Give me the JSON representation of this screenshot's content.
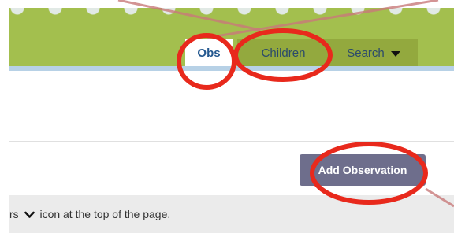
{
  "nav": {
    "tabs": [
      {
        "label": "Obs",
        "active": true
      },
      {
        "label": "Children",
        "active": false
      },
      {
        "label": "Search",
        "active": false
      }
    ]
  },
  "main": {
    "add_button_label": "Add Observation",
    "info_text_before": "rs",
    "info_icon": "chevron-down-icon",
    "info_text_after": "icon at the top of the page."
  },
  "colors": {
    "header_green": "#a3bf4e",
    "tab_green": "#93a93e",
    "active_tab_text": "#24588f",
    "button_bg": "#6e6e8c",
    "annotation_red": "#e8291c"
  }
}
